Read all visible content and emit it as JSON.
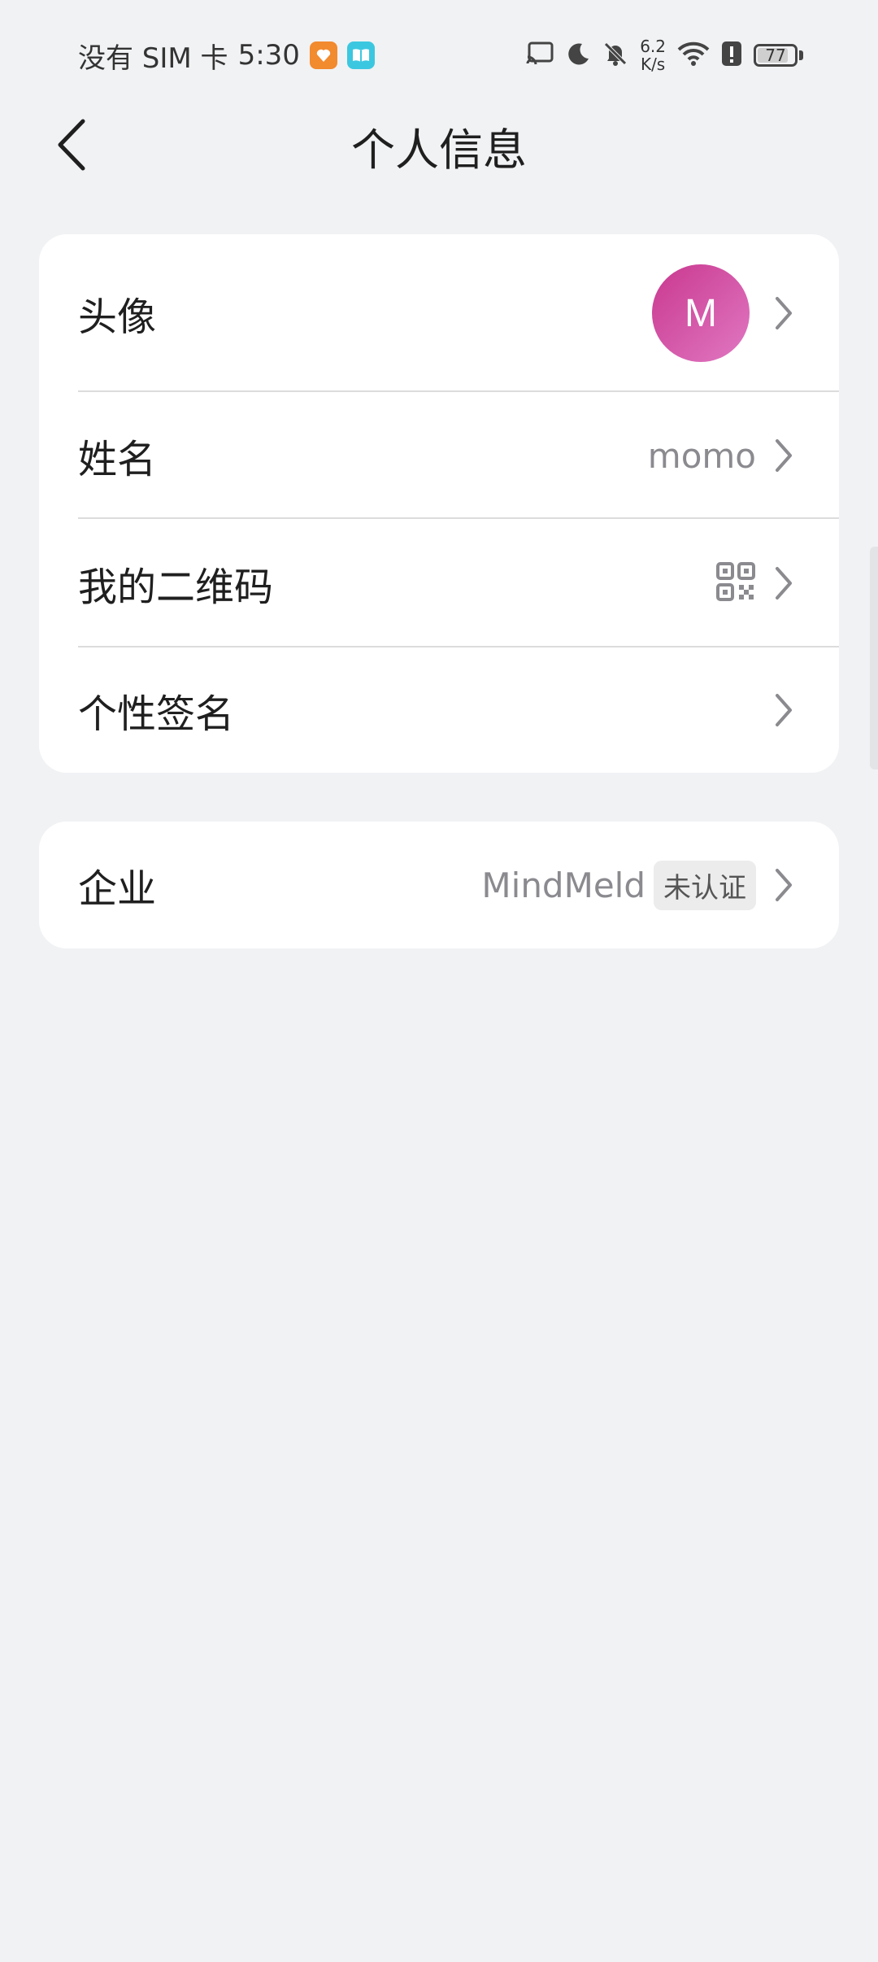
{
  "status_bar": {
    "carrier": "没有 SIM 卡",
    "time": "5:30",
    "net_speed_value": "6.2",
    "net_speed_unit": "K/s",
    "battery": "77"
  },
  "header": {
    "title": "个人信息"
  },
  "profile": {
    "avatar_label": "头像",
    "avatar_initial": "M",
    "name_label": "姓名",
    "name_value": "momo",
    "qr_label": "我的二维码",
    "signature_label": "个性签名"
  },
  "company": {
    "label": "企业",
    "value": "MindMeld",
    "status": "未认证"
  },
  "colors": {
    "background": "#f1f2f4",
    "avatar_gradient_start": "#c9388f",
    "avatar_gradient_end": "#e078c2"
  }
}
